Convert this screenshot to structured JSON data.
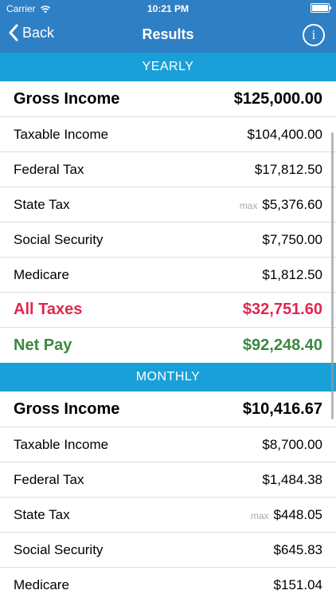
{
  "status": {
    "carrier": "Carrier",
    "time": "10:21 PM"
  },
  "nav": {
    "back_label": "Back",
    "title": "Results",
    "info_symbol": "i"
  },
  "yearly": {
    "header": "YEARLY",
    "gross_label": "Gross Income",
    "gross_value": "$125,000.00",
    "taxable_label": "Taxable Income",
    "taxable_value": "$104,400.00",
    "federal_label": "Federal Tax",
    "federal_value": "$17,812.50",
    "state_label": "State Tax",
    "state_max": "max",
    "state_value": "$5,376.60",
    "ss_label": "Social Security",
    "ss_value": "$7,750.00",
    "medicare_label": "Medicare",
    "medicare_value": "$1,812.50",
    "taxes_label": "All Taxes",
    "taxes_value": "$32,751.60",
    "net_label": "Net Pay",
    "net_value": "$92,248.40"
  },
  "monthly": {
    "header": "MONTHLY",
    "gross_label": "Gross Income",
    "gross_value": "$10,416.67",
    "taxable_label": "Taxable Income",
    "taxable_value": "$8,700.00",
    "federal_label": "Federal Tax",
    "federal_value": "$1,484.38",
    "state_label": "State Tax",
    "state_max": "max",
    "state_value": "$448.05",
    "ss_label": "Social Security",
    "ss_value": "$645.83",
    "medicare_label": "Medicare",
    "medicare_value": "$151.04"
  },
  "colors": {
    "nav_blue": "#2f7fc4",
    "section_blue": "#1aa0d8",
    "taxes_red": "#e0274e",
    "net_green": "#39893f"
  },
  "icons": {
    "wifi": "wifi-icon",
    "battery": "battery-icon",
    "back": "chevron-left-icon",
    "info": "info-icon"
  }
}
